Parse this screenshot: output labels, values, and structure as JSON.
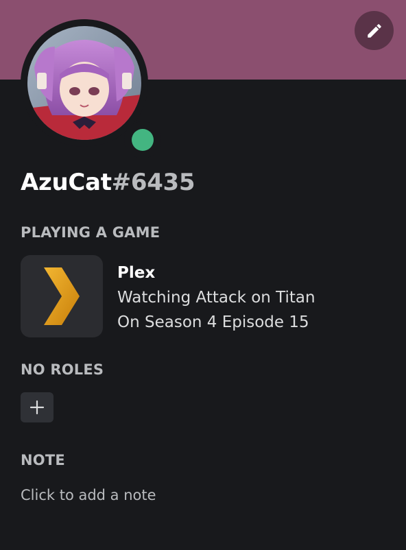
{
  "colors": {
    "banner": "#8b4f6f",
    "background": "#18191c",
    "status_online": "#43b581",
    "plex_orange": "#e5a00d"
  },
  "header": {
    "edit_icon": "pencil-icon"
  },
  "profile": {
    "username": "AzuCat",
    "discriminator": "#6435",
    "status": "online"
  },
  "activity": {
    "section_title": "PLAYING A GAME",
    "icon": "plex-logo-icon",
    "name": "Plex",
    "details": "Watching Attack on Titan",
    "state": "On Season 4 Episode 15"
  },
  "roles": {
    "section_title": "NO ROLES",
    "add_icon": "plus-icon"
  },
  "note": {
    "section_title": "NOTE",
    "placeholder": "Click to add a note"
  }
}
